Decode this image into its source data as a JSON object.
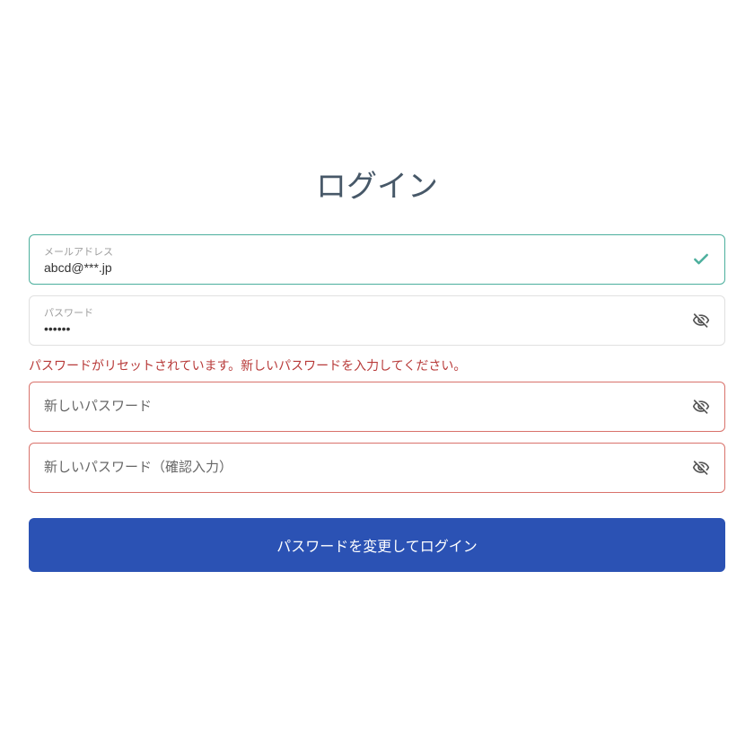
{
  "title": "ログイン",
  "email": {
    "label": "メールアドレス",
    "value": "abcd@***.jp"
  },
  "password": {
    "label": "パスワード",
    "value": "••••••"
  },
  "error_message": "パスワードがリセットされています。新しいパスワードを入力してください。",
  "new_password": {
    "placeholder": "新しいパスワード"
  },
  "confirm_password": {
    "placeholder": "新しいパスワード（確認入力）"
  },
  "submit_label": "パスワードを変更してログイン"
}
